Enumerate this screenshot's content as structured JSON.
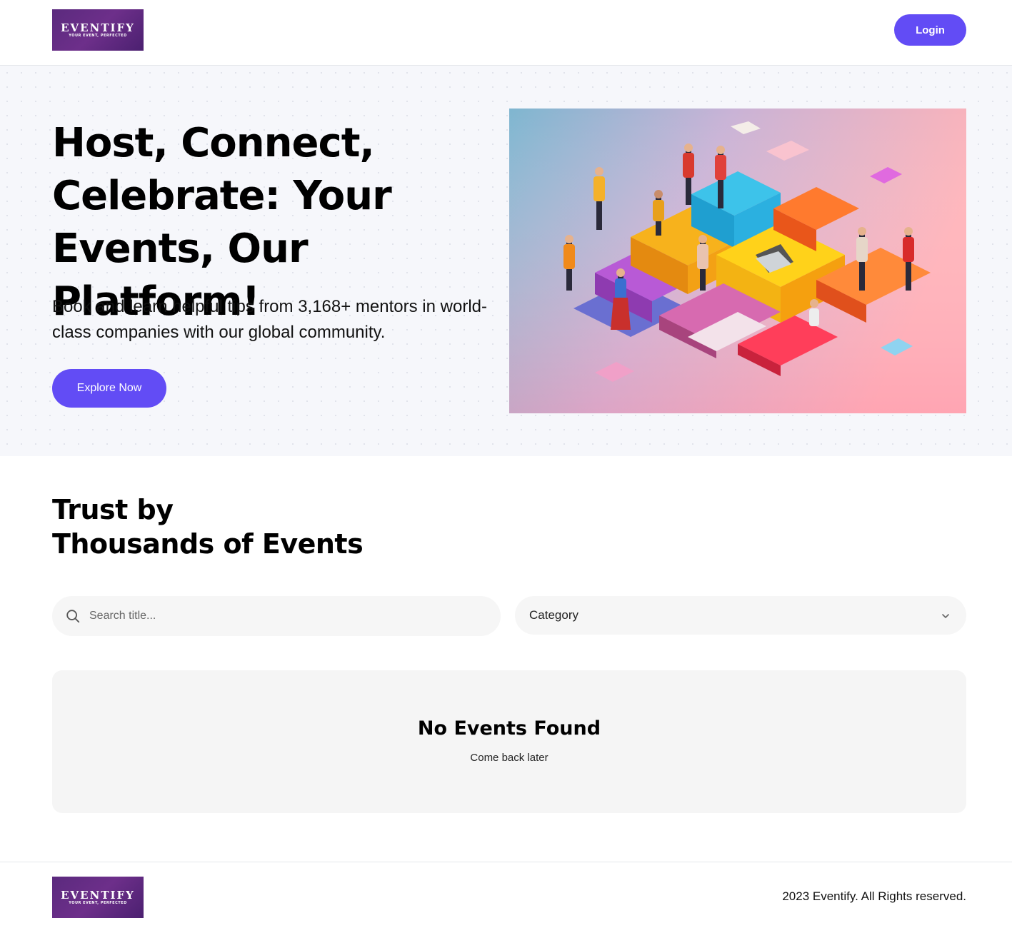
{
  "header": {
    "logo": {
      "word": "EVENTIFY",
      "tagline": "YOUR EVENT, PERFECTED"
    },
    "login_label": "Login"
  },
  "hero": {
    "title": "Host, Connect, Celebrate: Your Events, Our Platform!",
    "subtitle": "Book and learn helpful tips from 3,168+ mentors in world-class companies with our global community.",
    "cta_label": "Explore Now",
    "illustration": "isometric-event-people-illustration"
  },
  "events": {
    "title_line1": "Trust by",
    "title_line2": "Thousands of Events",
    "search": {
      "placeholder": "Search title...",
      "icon": "search-icon"
    },
    "category": {
      "selected": "Category",
      "icon": "chevron-down-icon"
    },
    "empty": {
      "title": "No Events Found",
      "subtitle": "Come back later"
    }
  },
  "footer": {
    "logo": {
      "word": "EVENTIFY",
      "tagline": "YOUR EVENT, PERFECTED"
    },
    "copyright": "2023 Eventify. All Rights reserved."
  },
  "colors": {
    "primary": "#624cf5",
    "logo_bg": "#5b2a7e",
    "hero_bg": "#f6f7fb",
    "input_bg": "#f6f6f6",
    "card_bg": "#f5f5f5"
  }
}
